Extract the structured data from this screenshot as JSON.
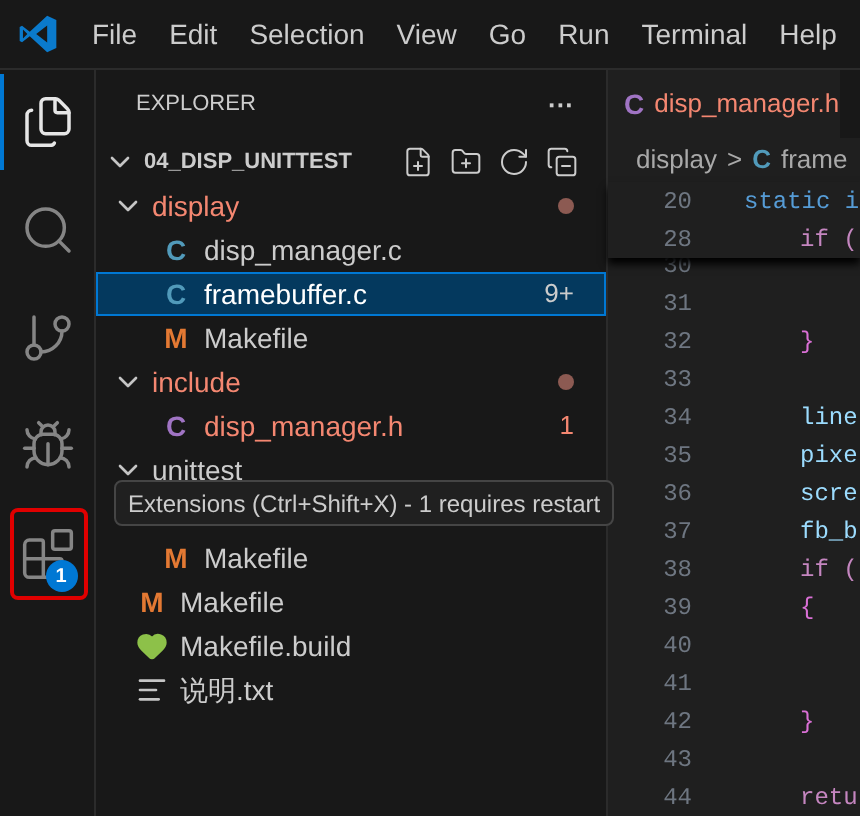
{
  "menu": [
    "File",
    "Edit",
    "Selection",
    "View",
    "Go",
    "Run",
    "Terminal",
    "Help"
  ],
  "activity_bar": [
    {
      "kind": "files",
      "selected": true
    },
    {
      "kind": "search",
      "selected": false
    },
    {
      "kind": "source-control",
      "selected": false
    },
    {
      "kind": "debug",
      "selected": false
    },
    {
      "kind": "extensions",
      "selected": false,
      "badge": "1",
      "highlighted": true
    }
  ],
  "tooltip": "Extensions (Ctrl+Shift+X) - 1 requires restart",
  "sidebar": {
    "title": "EXPLORER",
    "more": "···",
    "root": {
      "label": "04_DISP_UNITTEST",
      "expanded": true,
      "children": [
        {
          "kind": "folder",
          "label": "display",
          "expanded": true,
          "error": true,
          "children": [
            {
              "kind": "file",
              "icon": "C",
              "label": "disp_manager.c",
              "error": false,
              "selected": false
            },
            {
              "kind": "file",
              "icon": "C",
              "label": "framebuffer.c",
              "error": false,
              "selected": true,
              "badge": "9+"
            },
            {
              "kind": "file",
              "icon": "M",
              "label": "Makefile",
              "error": false,
              "selected": false
            }
          ]
        },
        {
          "kind": "folder",
          "label": "include",
          "expanded": true,
          "error": true,
          "children": [
            {
              "kind": "file",
              "icon": "C",
              "label": "disp_manager.h",
              "error": true,
              "selected": false,
              "badge": "1"
            }
          ]
        },
        {
          "kind": "folder",
          "label": "unittest",
          "expanded": true,
          "error": false,
          "children": [
            {
              "kind": "hidden"
            },
            {
              "kind": "file",
              "icon": "M",
              "label": "Makefile",
              "error": false,
              "selected": false
            }
          ]
        },
        {
          "kind": "file",
          "icon": "M",
          "label": "Makefile",
          "error": false,
          "selected": false
        },
        {
          "kind": "heart",
          "label": "Makefile.build",
          "error": false,
          "selected": false
        },
        {
          "kind": "text",
          "label": "说明.txt",
          "error": false,
          "selected": false
        }
      ]
    }
  },
  "editor": {
    "tab": {
      "icon": "C",
      "label": "disp_manager.h",
      "error": true
    },
    "breadcrumb": {
      "folder": "display",
      "sep": ">",
      "icon": "C",
      "file": "frame"
    },
    "sticky": {
      "number": "20",
      "code": "static i",
      "kind": "keyword",
      "children": [
        {
          "number": "28",
          "code": "if (",
          "kind": "control"
        }
      ]
    },
    "lines": [
      {
        "number": "30"
      },
      {
        "number": "31"
      },
      {
        "number": "32",
        "code": "}",
        "kind": "brace"
      },
      {
        "number": "33"
      },
      {
        "number": "34",
        "code": "line",
        "kind": "ident"
      },
      {
        "number": "35",
        "code": "pixe",
        "kind": "ident"
      },
      {
        "number": "36",
        "code": "scre",
        "kind": "ident"
      },
      {
        "number": "37",
        "code": "fb_b",
        "kind": "ident"
      },
      {
        "number": "38",
        "code": "if (",
        "kind": "control"
      },
      {
        "number": "39",
        "code": "{",
        "kind": "brace"
      },
      {
        "number": "40"
      },
      {
        "number": "41"
      },
      {
        "number": "42",
        "code": "}",
        "kind": "brace"
      },
      {
        "number": "43"
      },
      {
        "number": "44",
        "code": "retu",
        "kind": "control"
      }
    ]
  }
}
